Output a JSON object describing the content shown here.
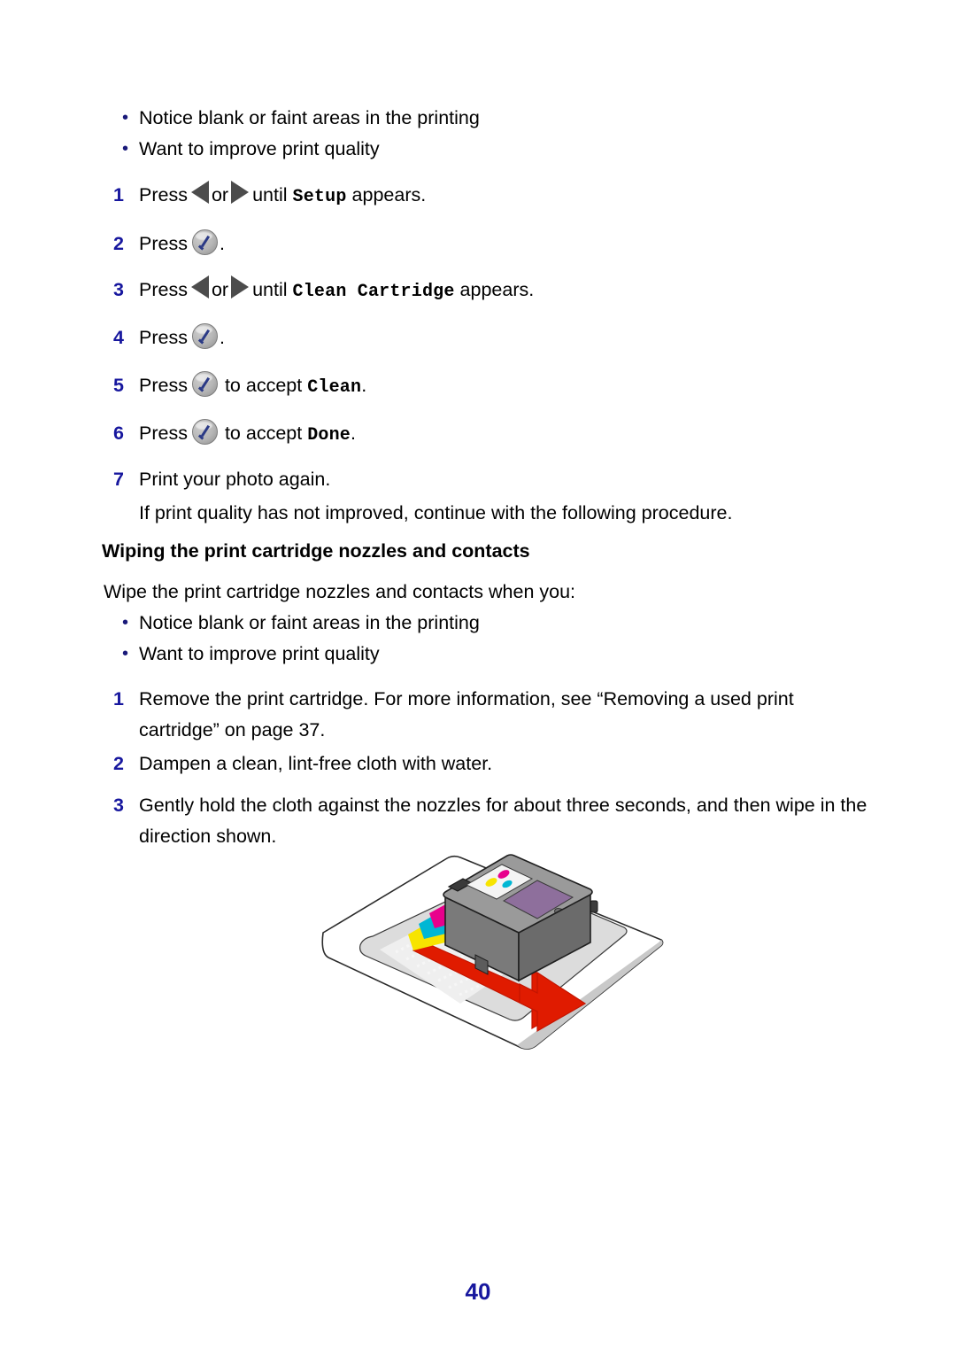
{
  "page": {
    "number": "40",
    "background": "#ffffff",
    "accent_blue": "#17179e",
    "bullet_blue": "#1a1a7a",
    "arrow_red": "#e01b00"
  },
  "top_bullets": [
    {
      "marker": "•",
      "text": "Notice blank or faint areas in the printing"
    },
    {
      "marker": "•",
      "text": "Want to improve print quality"
    }
  ],
  "cleaning_steps": [
    {
      "number": "1",
      "pre": "Press",
      "mid": "or",
      "post": "until",
      "mono": "Setup",
      "tail": "appears.",
      "icons": [
        "arrow-left-icon",
        "arrow-right-icon"
      ]
    },
    {
      "number": "2",
      "pre": "Press",
      "tail": ".",
      "icons": [
        "select-button-icon"
      ]
    },
    {
      "number": "3",
      "pre": "Press",
      "mid": "or",
      "post": "until",
      "mono": "Clean Cartridge",
      "tail": "appears.",
      "icons": [
        "arrow-left-icon",
        "arrow-right-icon"
      ]
    },
    {
      "number": "4",
      "pre": "Press",
      "tail": ".",
      "icons": [
        "select-button-icon"
      ]
    },
    {
      "number": "5",
      "pre": "Press",
      "post": "to accept",
      "mono": "Clean",
      "tail": ".",
      "icons": [
        "select-button-icon"
      ]
    },
    {
      "number": "6",
      "pre": "Press",
      "post": "to accept",
      "mono": "Done",
      "tail": ".",
      "icons": [
        "select-button-icon"
      ]
    },
    {
      "number": "7",
      "pre": "Print your photo again.",
      "icons": []
    }
  ],
  "note": "If print quality has not improved, continue with the following procedure.",
  "section": {
    "heading": "Wiping the print cartridge nozzles and contacts",
    "intro": "Wipe the print cartridge nozzles and contacts when you:",
    "bullets": [
      {
        "marker": "•",
        "text": "Notice blank or faint areas in the printing"
      },
      {
        "marker": "•",
        "text": "Want to improve print quality"
      }
    ],
    "steps": [
      {
        "number": "1",
        "text": "Remove the print cartridge. For more information, see “Removing a used print cartridge” on page 37."
      },
      {
        "number": "2",
        "text": "Dampen a clean, lint-free cloth with water."
      },
      {
        "number": "3",
        "text": "Gently hold the cloth against the nozzles for about three seconds, and then wipe in the direction shown."
      }
    ]
  },
  "illustration": {
    "name": "print-cartridge-on-cloth-illustration",
    "elements": [
      "lint-free-cloth",
      "print-cartridge",
      "color-nozzle-strip",
      "wipe-direction-arrow"
    ],
    "colors": {
      "cloth": "#ffffff",
      "cloth_shade": "#d9d9d9",
      "cartridge_body": "#6d6d6d",
      "cartridge_top": "#8c8c8c",
      "cartridge_label": "#f2f2f2",
      "cartridge_window": "#8e6f9c",
      "nozzle_cyan": "#00b7d4",
      "nozzle_magenta": "#e8008c",
      "nozzle_yellow": "#f7e400",
      "arrow": "#e01b00",
      "outline": "#1a1a1a"
    }
  }
}
